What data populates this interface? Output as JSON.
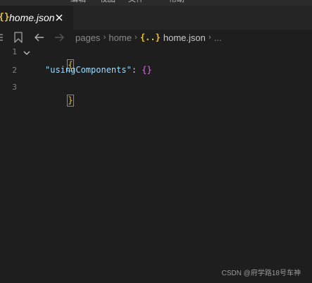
{
  "menubar": {
    "items": [
      "编辑",
      "视图",
      "文件",
      "帮助"
    ]
  },
  "tab": {
    "icon": "{}",
    "label": "home.json",
    "close_icon": "close-icon"
  },
  "toolbar": {
    "icons": [
      "list-icon",
      "bookmark-icon",
      "back-arrow-icon",
      "forward-arrow-icon"
    ]
  },
  "breadcrumb": {
    "items": [
      "pages",
      "home"
    ],
    "file_icon": "{..}",
    "file": "home.json",
    "more": "..."
  },
  "editor": {
    "lines": [
      {
        "number": "1",
        "text": "{"
      },
      {
        "number": "2",
        "key": "\"usingComponents\"",
        "colon": ": ",
        "value": "{}"
      },
      {
        "number": "3",
        "text": "}"
      }
    ]
  },
  "watermark": "CSDN @府学路18号车神",
  "colors": {
    "background": "#1e1e1e",
    "json_icon": "#e8c23b",
    "key": "#9cdcfe",
    "object": "#da70d6"
  }
}
